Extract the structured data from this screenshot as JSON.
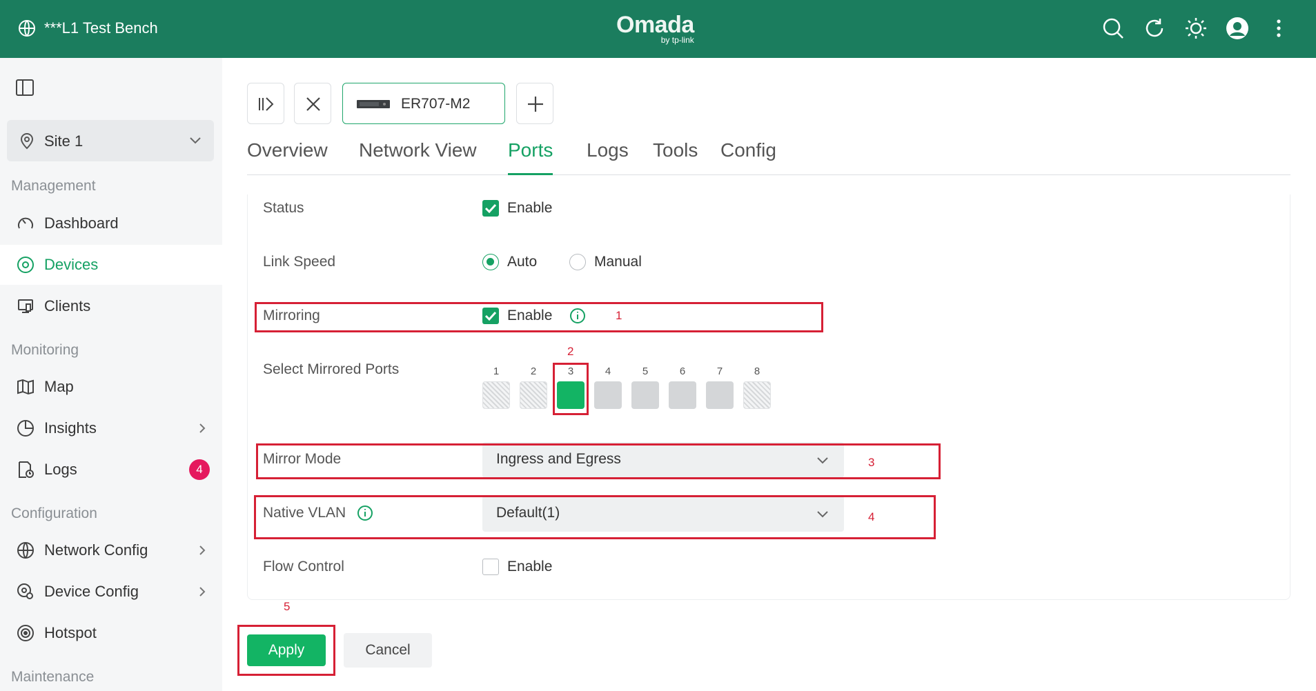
{
  "header": {
    "site_name": "***L1 Test Bench",
    "logo_text": "Omada",
    "logo_sub": "by tp-link",
    "icons": [
      "search-icon",
      "refresh-icon",
      "theme-icon",
      "avatar",
      "more-vertical-icon"
    ]
  },
  "sidebar": {
    "site_selector": "Site 1",
    "sections": {
      "management": "Management",
      "monitoring": "Monitoring",
      "configuration": "Configuration",
      "maintenance": "Maintenance"
    },
    "items": [
      {
        "label": "Dashboard",
        "icon": "dashboard-icon"
      },
      {
        "label": "Devices",
        "icon": "devices-icon",
        "active": true
      },
      {
        "label": "Clients",
        "icon": "clients-icon"
      },
      {
        "label": "Map",
        "icon": "map-icon"
      },
      {
        "label": "Insights",
        "icon": "insights-icon"
      },
      {
        "label": "Logs",
        "icon": "logs-icon",
        "badge": "4"
      },
      {
        "label": "Network Config",
        "icon": "globe-icon"
      },
      {
        "label": "Device Config",
        "icon": "device-config-icon"
      },
      {
        "label": "Hotspot",
        "icon": "hotspot-icon"
      }
    ]
  },
  "device_bar": {
    "device_name": "ER707-M2"
  },
  "tabs": [
    "Overview",
    "Network View",
    "Ports",
    "Logs",
    "Tools",
    "Config"
  ],
  "active_tab": "Ports",
  "form": {
    "status": {
      "label": "Status",
      "option": "Enable",
      "checked": true
    },
    "link_speed": {
      "label": "Link Speed",
      "options": [
        "Auto",
        "Manual"
      ],
      "selected": "Auto"
    },
    "mirroring": {
      "label": "Mirroring",
      "option": "Enable",
      "checked": true
    },
    "mirrored_ports": {
      "label": "Select Mirrored Ports",
      "ports": [
        "1",
        "2",
        "3",
        "4",
        "5",
        "6",
        "7",
        "8"
      ],
      "selected": "3"
    },
    "mirror_mode": {
      "label": "Mirror Mode",
      "value": "Ingress and Egress"
    },
    "native_vlan": {
      "label": "Native VLAN",
      "value": "Default(1)"
    },
    "flow_control": {
      "label": "Flow Control",
      "option": "Enable",
      "checked": false
    }
  },
  "annotations": [
    "1",
    "2",
    "3",
    "4",
    "5"
  ],
  "buttons": {
    "apply": "Apply",
    "cancel": "Cancel"
  },
  "colors": {
    "header_bg": "#1b7d5e",
    "accent": "#15a163",
    "annotation": "#d62035",
    "badge": "#e5195e"
  }
}
